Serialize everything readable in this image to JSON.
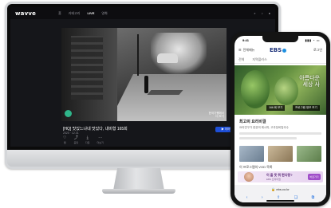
{
  "monitor": {
    "app": {
      "logo": "wavve",
      "nav": [
        "홈",
        "카테고리",
        "LIVE",
        "영화"
      ],
      "nav_active_index": 2,
      "top_right_icons": [
        "search-icon",
        "bell-icon",
        "user-icon"
      ]
    },
    "video": {
      "overlay_text": [
        "한국기행에서",
        "더 보기"
      ]
    },
    "episode": {
      "title": "[HQ] 맛있느냐네 맛있다, 내비형 165회",
      "meta": "2020 · 12.31",
      "play_label": "▶ 이어보기"
    },
    "actions": [
      {
        "icon": "heart-icon",
        "label": "찜"
      },
      {
        "icon": "share-icon",
        "label": "공유"
      },
      {
        "icon": "download-icon",
        "label": "다운"
      },
      {
        "icon": "more-icon",
        "label": "더보기"
      }
    ]
  },
  "phone": {
    "status": {
      "time": "9:41",
      "signal": "▮▮▮ ◔ ▭"
    },
    "header": {
      "left": "전체메뉴",
      "logo": "EBS",
      "right": "로그인"
    },
    "tabs": [
      "전체",
      "지역플러스"
    ],
    "hero": {
      "caption_line1": "아름다운",
      "caption_line2": "세상 사",
      "button_a": "166 회 보기",
      "button_b": "프로그램 정보 보기"
    },
    "section": {
      "title": "최고의 요리비결",
      "subtitle": "요리연구가 한권의 레시피, 고추장비빔국수"
    },
    "list_title": "이 프로그램의 VOD 목록",
    "banner": {
      "text": "이 올 듯 뭐 편다랑?",
      "sub": "EBS 프리미엄",
      "badge": "바로가기"
    },
    "url": "🔒 ebs.co.kr",
    "toolbar_icons": [
      "‹",
      "›",
      "⇪",
      "❏",
      "⧉"
    ]
  },
  "colors": {
    "accent_blue": "#1e4fd8",
    "ebs_navy": "#1a2f78",
    "wavve_bg": "#15161a"
  }
}
